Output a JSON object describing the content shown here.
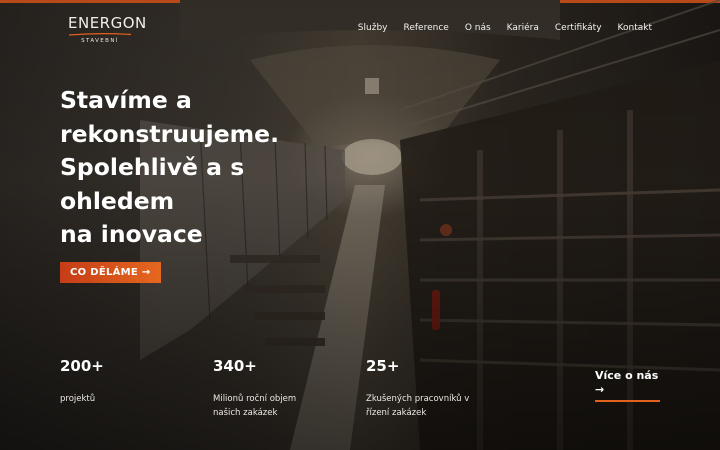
{
  "header": {
    "logo": {
      "name": "ENERGON",
      "subtitle": "STAVEBNÍ"
    },
    "nav": [
      {
        "label": "Služby"
      },
      {
        "label": "Reference"
      },
      {
        "label": "O nás"
      },
      {
        "label": "Kariéra"
      },
      {
        "label": "Certifikáty"
      },
      {
        "label": "Kontakt"
      }
    ]
  },
  "hero": {
    "headline_lines": [
      "Stavíme a",
      "rekonstruujeme.",
      "Spolehlivě a s",
      "ohledem",
      "na inovace"
    ],
    "cta_label": "CO DĚLÁME →",
    "background": "dark utility tunnel with cable trays"
  },
  "stats": [
    {
      "value": "200+",
      "label_lines": [
        "projektů"
      ]
    },
    {
      "value": "340+",
      "label_lines": [
        "Milionů roční objem",
        "našich zakázek"
      ]
    },
    {
      "value": "25+",
      "label_lines": [
        "Zkušených pracovníků v",
        "řízení zakázek"
      ]
    }
  ],
  "more_link": {
    "label": "Více o nás",
    "arrow": "→"
  },
  "colors": {
    "accent": "#e0621d",
    "accent_dark": "#c53d17",
    "text": "#ffffff"
  }
}
